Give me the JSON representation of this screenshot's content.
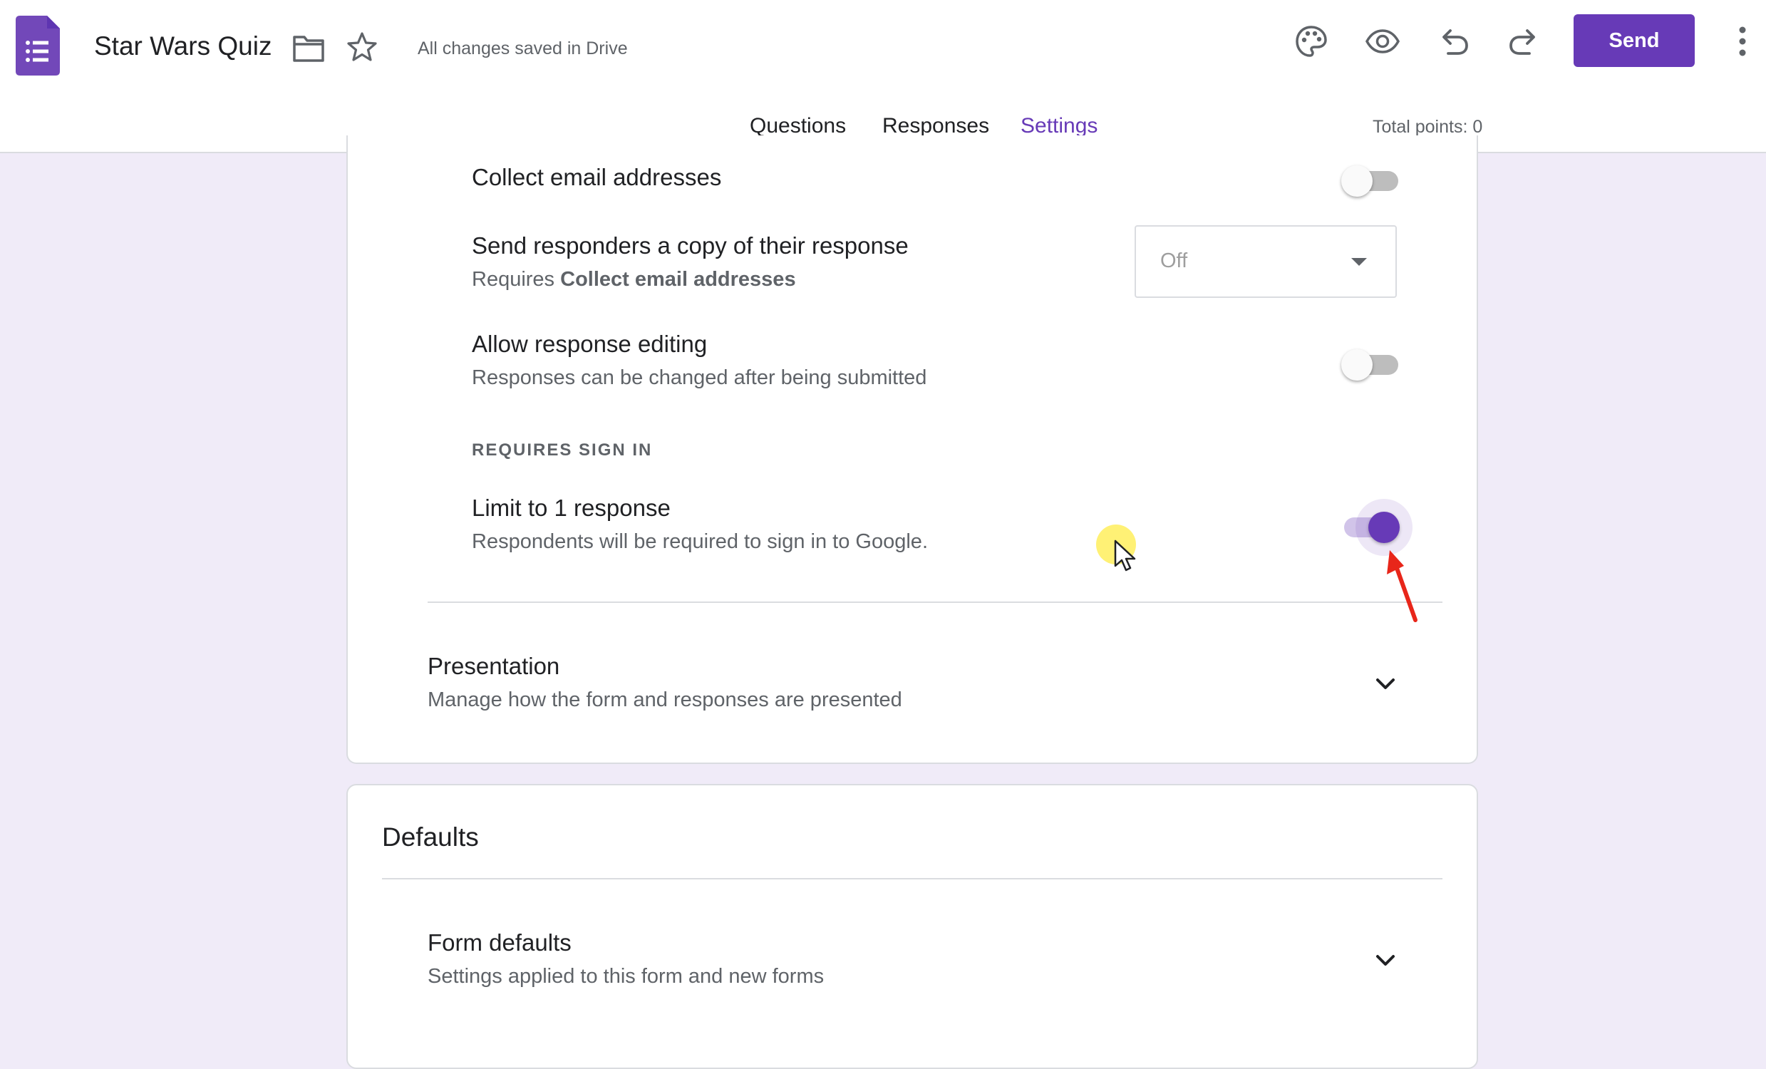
{
  "header": {
    "doc_title": "Star Wars Quiz",
    "save_status": "All changes saved in Drive",
    "send_label": "Send",
    "total_points": "Total points: 0",
    "icons": [
      "forms-logo-icon",
      "folder-icon",
      "star-icon",
      "palette-icon",
      "eye-icon",
      "undo-icon",
      "redo-icon",
      "more-vert-icon"
    ],
    "brand_color": "#673ab7"
  },
  "tabs": [
    {
      "label": "Questions",
      "active": false
    },
    {
      "label": "Responses",
      "active": false
    },
    {
      "label": "Settings",
      "active": true
    }
  ],
  "responses_settings": {
    "collect_email": {
      "title": "Collect email addresses",
      "on": false
    },
    "send_copy": {
      "title": "Send responders a copy of their response",
      "desc_prefix": "Requires ",
      "desc_bold": "Collect email addresses",
      "value": "Off"
    },
    "allow_editing": {
      "title": "Allow response editing",
      "desc": "Responses can be changed after being submitted",
      "on": false
    },
    "requires_sign_in_label": "REQUIRES SIGN IN",
    "limit_one": {
      "title": "Limit to 1 response",
      "desc": "Respondents will be required to sign in to Google.",
      "on": true
    }
  },
  "presentation": {
    "title": "Presentation",
    "desc": "Manage how the form and responses are presented"
  },
  "defaults": {
    "title": "Defaults",
    "form_defaults": {
      "title": "Form defaults",
      "desc": "Settings applied to this form and new forms"
    }
  }
}
